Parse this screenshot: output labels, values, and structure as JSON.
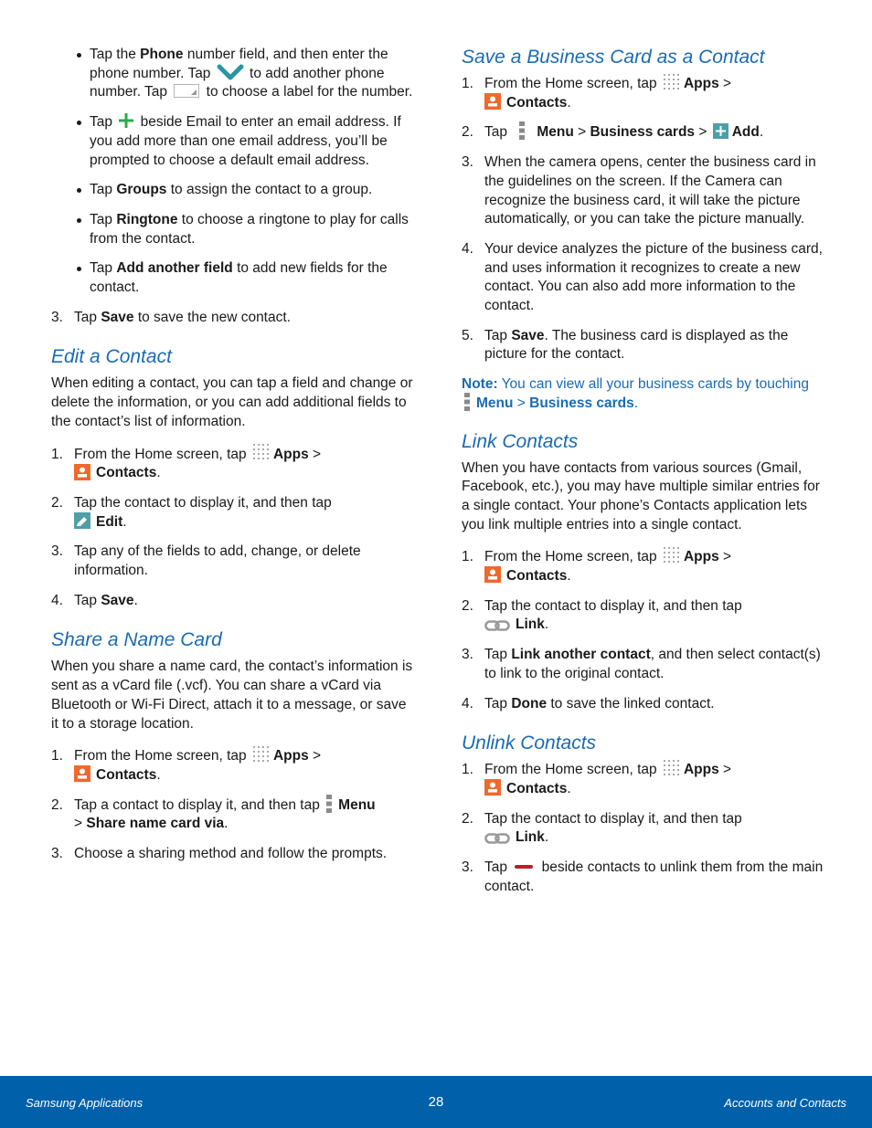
{
  "colors": {
    "heading": "#1a6bb3",
    "footer_bg": "#0060a9",
    "contacts_icon": "#f0682b",
    "teal_icon": "#4f9ea8",
    "check_icon": "#2a94a8",
    "plus_icon": "#2fa84f",
    "minus_icon": "#b8202b"
  },
  "left": {
    "bullets": [
      {
        "pre": "Tap the ",
        "bold": "Phone",
        "mid": " number field, and then enter the phone number. Tap ",
        "icon1": "chevron-down-icon",
        "mid2": " to add another phone number. Tap ",
        "icon2": "label-dropdown-icon",
        "post": " to choose a label for the number."
      },
      {
        "pre": "Tap ",
        "icon": "plus-icon",
        "post": " beside Email to enter an email address. If you add more than one email address, you’ll be prompted to choose a default email address."
      },
      {
        "pre": "Tap ",
        "bold": "Groups",
        "post": " to assign the contact to a group."
      },
      {
        "pre": "Tap ",
        "bold": "Ringtone",
        "post": " to choose a ringtone to play for calls from the contact."
      },
      {
        "pre": "Tap ",
        "bold": "Add another field",
        "post": " to add new fields for the contact."
      }
    ],
    "step3": {
      "num": "3.",
      "pre": "Tap ",
      "bold": "Save",
      "post": " to save the new contact."
    },
    "edit": {
      "title": "Edit a Contact",
      "intro": "When editing a contact, you can tap a field and change or delete the information, or you can add additional fields to the contact’s list of information.",
      "steps": [
        {
          "num": "1.",
          "pre": "From the Home screen, tap ",
          "b1": "Apps",
          "sep": " >",
          "b2": "Contacts",
          "end": "."
        },
        {
          "num": "2.",
          "pre": "Tap the contact to display it, and then tap",
          "b1": "Edit",
          "end": "."
        },
        {
          "num": "3.",
          "text": "Tap any of the fields to add, change, or delete information."
        },
        {
          "num": "4.",
          "pre": "Tap ",
          "b1": "Save",
          "end": "."
        }
      ]
    },
    "share": {
      "title": "Share a Name Card",
      "intro": "When you share a name card, the contact’s information is sent as a vCard file (.vcf). You can share a vCard via Bluetooth or Wi-Fi Direct, attach it to a message, or save it to a storage location.",
      "steps": [
        {
          "num": "1.",
          "pre": "From the Home screen, tap ",
          "b1": "Apps",
          "sep": " >",
          "b2": "Contacts",
          "end": "."
        },
        {
          "num": "2.",
          "pre": "Tap a contact to display it, and then tap ",
          "b1": "Menu",
          "sep": "> ",
          "b2": "Share name card via",
          "end": "."
        },
        {
          "num": "3.",
          "text": "Choose a sharing method and follow the prompts."
        }
      ]
    }
  },
  "right": {
    "business": {
      "title": "Save a Business Card as a Contact",
      "steps": [
        {
          "num": "1.",
          "pre": "From the Home screen, tap ",
          "b1": "Apps",
          "sep": " >",
          "b2": "Contacts",
          "end": "."
        },
        {
          "num": "2.",
          "pre": "Tap ",
          "b1": "Menu",
          "sep1": " > ",
          "b2": "Business cards",
          "sep2": " > ",
          "b3": "Add",
          "end": "."
        },
        {
          "num": "3.",
          "text": "When the camera opens, center the business card in the guidelines on the screen. If the Camera can recognize the business card, it will take the picture automatically, or you can take the picture manually."
        },
        {
          "num": "4.",
          "text": "Your device analyzes the picture of the business card, and uses information it recognizes to create a new contact. You can also add more information to the contact."
        },
        {
          "num": "5.",
          "pre": "Tap ",
          "b1": "Save",
          "post": ". The business card is displayed as the picture for the contact."
        }
      ],
      "note": {
        "label": "Note:",
        "pre": " You can view all your business cards by touching ",
        "b1": "Menu",
        "sep": " > ",
        "b2": "Business cards",
        "end": "."
      }
    },
    "link": {
      "title": "Link Contacts",
      "intro": "When you have contacts from various sources (Gmail, Facebook, etc.), you may have multiple similar entries for a single contact. Your phone’s Contacts application lets you link multiple entries into a single contact.",
      "steps": [
        {
          "num": "1.",
          "pre": "From the Home screen, tap ",
          "b1": "Apps",
          "sep": " >",
          "b2": "Contacts",
          "end": "."
        },
        {
          "num": "2.",
          "pre": "Tap the contact to display it, and then tap",
          "b1": "Link",
          "end": "."
        },
        {
          "num": "3.",
          "pre": "Tap ",
          "b1": "Link another contact",
          "post": ", and then select contact(s) to link to the original contact."
        },
        {
          "num": "4.",
          "pre": "Tap ",
          "b1": "Done",
          "post": " to save the linked contact."
        }
      ]
    },
    "unlink": {
      "title": "Unlink Contacts",
      "steps": [
        {
          "num": "1.",
          "pre": "From the Home screen, tap ",
          "b1": "Apps",
          "sep": " >",
          "b2": "Contacts",
          "end": "."
        },
        {
          "num": "2.",
          "pre": "Tap the contact to display it, and then tap",
          "b1": "Link",
          "end": "."
        },
        {
          "num": "3.",
          "pre": "Tap ",
          "post": " beside contacts to unlink them from the main contact."
        }
      ]
    }
  },
  "footer": {
    "left": "Samsung Applications",
    "page": "28",
    "right": "Accounts and Contacts"
  }
}
